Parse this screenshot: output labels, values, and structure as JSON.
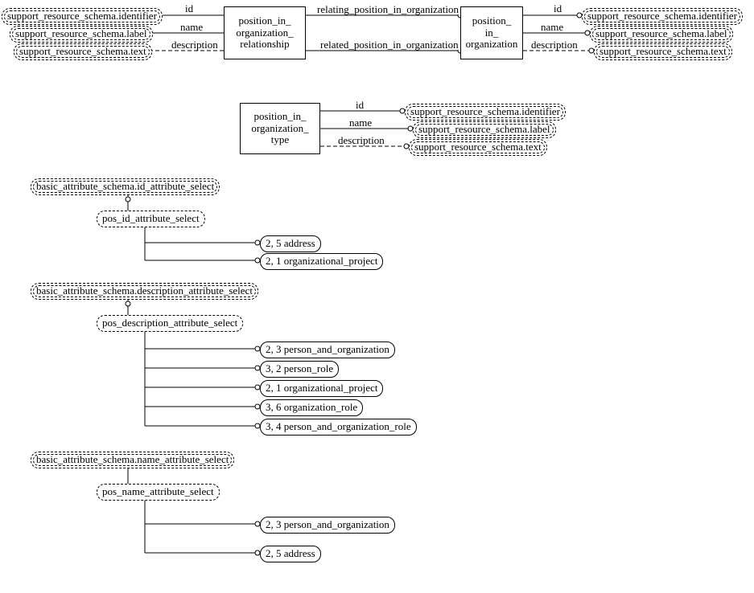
{
  "top": {
    "left_refs": {
      "id": "support_resource_schema.identifier",
      "name": "support_resource_schema.label",
      "desc": "support_resource_schema.text"
    },
    "entity_relationship": "position_in_\norganization_\nrelationship",
    "rel_labels": {
      "id": "id",
      "name": "name",
      "desc": "description",
      "relating": "relating_position_in_organization",
      "related": "related_position_in_organization"
    },
    "entity_org": "position_\nin_\norganization",
    "right_refs": {
      "id": "support_resource_schema.identifier",
      "name": "support_resource_schema.label",
      "desc": "support_resource_schema.text"
    }
  },
  "mid": {
    "entity_type": "position_in_\norganization_\ntype",
    "labels": {
      "id": "id",
      "name": "name",
      "desc": "description"
    },
    "refs": {
      "id": "support_resource_schema.identifier",
      "name": "support_resource_schema.label",
      "desc": "support_resource_schema.text"
    }
  },
  "tree1": {
    "parent": "basic_attribute_schema.id_attribute_select",
    "select": "pos_id_attribute_select",
    "items": [
      "2, 5 address",
      "2, 1 organizational_project"
    ]
  },
  "tree2": {
    "parent": "basic_attribute_schema.description_attribute_select",
    "select": "pos_description_attribute_select",
    "items": [
      "2, 3 person_and_organization",
      "3, 2 person_role",
      "2, 1 organizational_project",
      "3, 6 organization_role",
      "3, 4 person_and_organization_role"
    ]
  },
  "tree3": {
    "parent": "basic_attribute_schema.name_attribute_select",
    "select": "pos_name_attribute_select",
    "items": [
      "2, 3 person_and_organization",
      "2, 5 address"
    ]
  }
}
